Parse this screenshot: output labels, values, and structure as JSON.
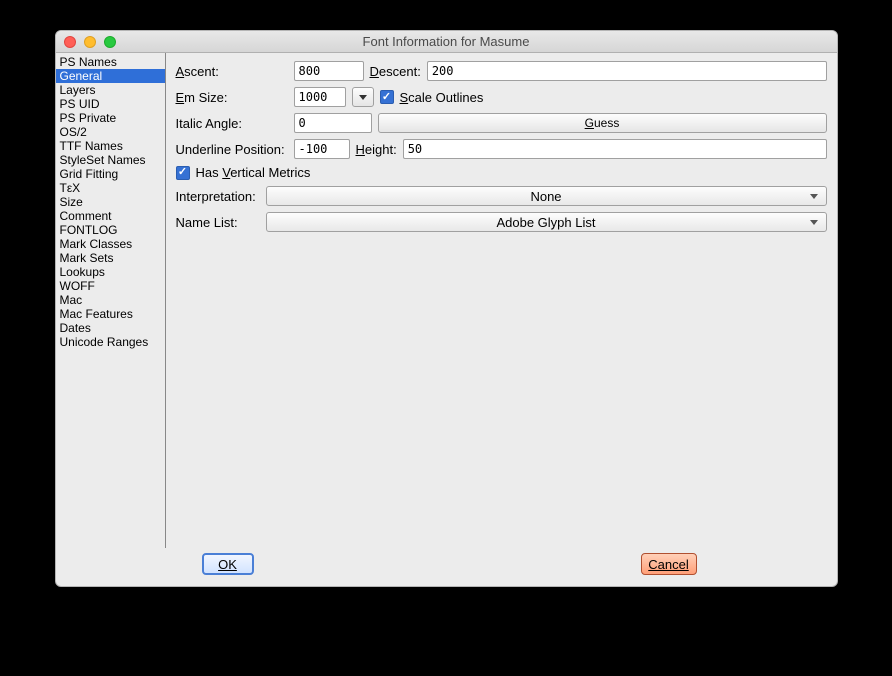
{
  "window": {
    "title": "Font Information for Masume"
  },
  "sidebar": {
    "items": [
      "PS Names",
      "General",
      "Layers",
      "PS UID",
      "PS Private",
      "OS/2",
      "TTF Names",
      "StyleSet Names",
      "Grid Fitting",
      "TεX",
      "Size",
      "Comment",
      "FONTLOG",
      "Mark Classes",
      "Mark Sets",
      "Lookups",
      "WOFF",
      "Mac",
      "Mac Features",
      "Dates",
      "Unicode Ranges"
    ],
    "selected_index": 1
  },
  "form": {
    "ascent_label_pre": "",
    "ascent_label_u": "A",
    "ascent_label_post": "scent:",
    "ascent_value": "800",
    "descent_label_u": "D",
    "descent_label_post": "escent:",
    "descent_value": "200",
    "em_label_u": "E",
    "em_label_post": "m Size:",
    "em_value": "1000",
    "scale_outlines_u": "S",
    "scale_outlines_post": "cale Outlines",
    "italic_label": "Italic Angle:",
    "italic_value": "0",
    "guess_u": "G",
    "guess_post": "uess",
    "underline_label": "Underline Position:",
    "underline_value": "-100",
    "height_label_u": "H",
    "height_label_post": "eight:",
    "height_value": "50",
    "vertical_label_pre": "Has ",
    "vertical_label_u": "V",
    "vertical_label_post": "ertical Metrics",
    "interpretation_label": "Interpretation:",
    "interpretation_value": "None",
    "namelist_label": "Name List:",
    "namelist_value": "Adobe Glyph List"
  },
  "footer": {
    "ok": "OK",
    "cancel": "Cancel"
  }
}
